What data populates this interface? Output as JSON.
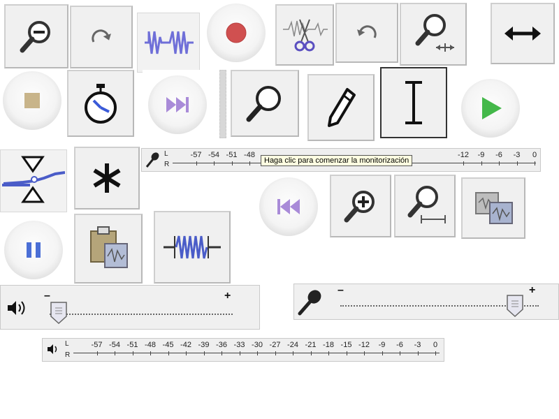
{
  "icons": {
    "zoom_out": "zoom-out-icon",
    "redo": "redo-icon",
    "trim": "trim-icon",
    "record": "record-icon",
    "cut": "cut-icon",
    "undo": "undo-icon",
    "zoom_fit": "zoom-fit-icon",
    "time_shift": "time-shift-icon",
    "stop": "stop-icon",
    "timer": "timer-icon",
    "skip_end": "skip-end-icon",
    "zoom": "zoom-icon",
    "draw": "pencil-icon",
    "select": "ibeam-icon",
    "play": "play-icon",
    "envelope": "envelope-icon",
    "multi": "asterisk-icon",
    "skip_start": "skip-start-icon",
    "zoom_in": "zoom-in-icon",
    "zoom_selection": "zoom-selection-icon",
    "pause": "pause-icon",
    "paste": "paste-icon",
    "silence": "silence-icon",
    "copy": "copy-icon",
    "speaker": "speaker-icon",
    "microphone": "microphone-icon"
  },
  "record_meter": {
    "left_label": "L",
    "right_label": "R",
    "ticks": [
      "-57",
      "-54",
      "-51",
      "-48",
      "-12",
      "-9",
      "-6",
      "-3",
      "0"
    ],
    "tooltip": "Haga clic para comenzar la monitorización"
  },
  "playback_meter": {
    "left_label": "L",
    "right_label": "R",
    "ticks": [
      "-57",
      "-54",
      "-51",
      "-48",
      "-45",
      "-42",
      "-39",
      "-36",
      "-33",
      "-30",
      "-27",
      "-24",
      "-21",
      "-18",
      "-15",
      "-12",
      "-9",
      "-6",
      "-3",
      "0"
    ]
  },
  "playback_volume": {
    "minus": "–",
    "plus": "+",
    "level": 0.05
  },
  "record_volume": {
    "minus": "–",
    "plus": "+",
    "level": 0.88
  },
  "colors": {
    "record_red": "#d05050",
    "play_green": "#44b84a",
    "transport_purple": "#a98bd8",
    "pause_blue": "#4b6fd6",
    "wave_blue": "#4a5cc8",
    "stop_tan": "#c8b48a"
  }
}
